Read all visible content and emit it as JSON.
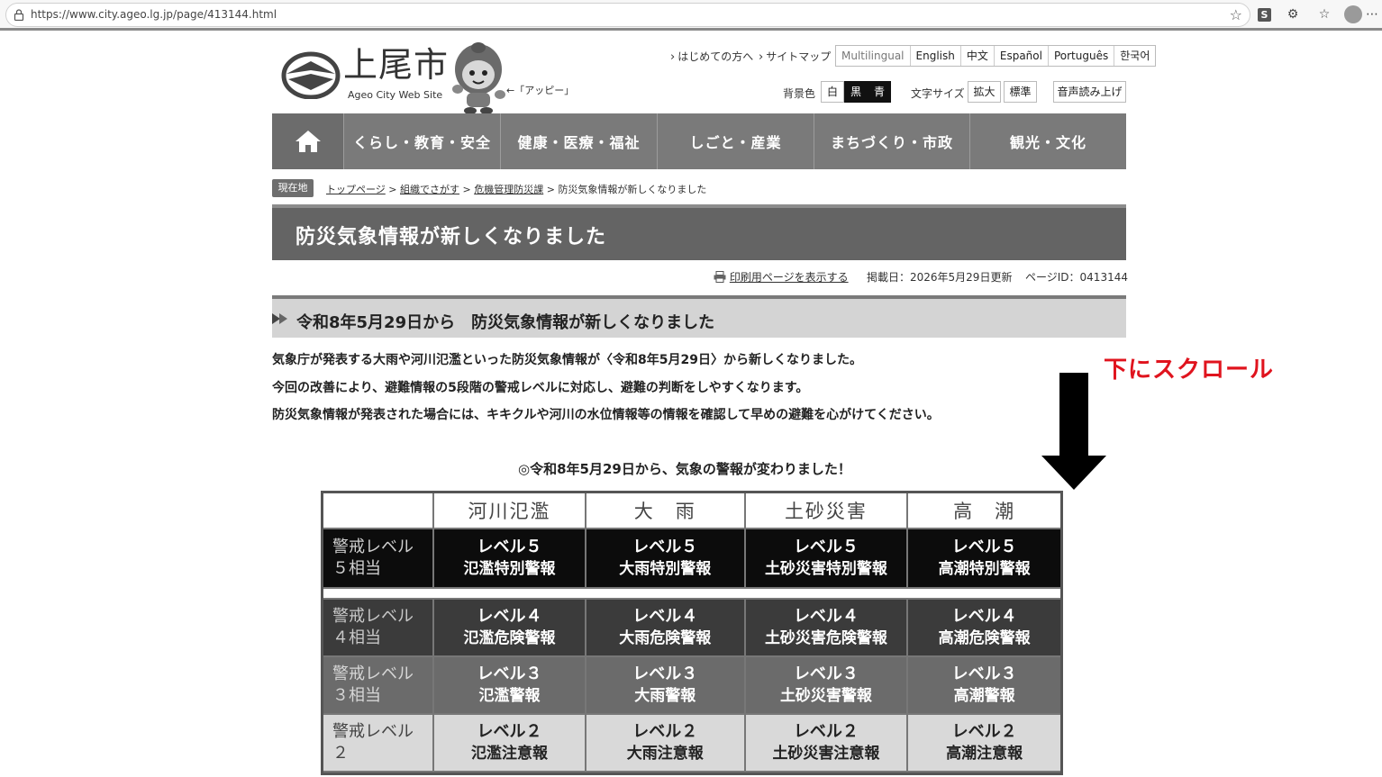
{
  "browser": {
    "url": "https://www.city.ageo.lg.jp/page/413144.html",
    "ext_label": "S"
  },
  "header": {
    "logo_title": "上尾市",
    "logo_sub": "Ageo City Web Site",
    "mascot_label": "←「アッピー」",
    "link_first": "はじめての方へ",
    "link_sitemap": "サイトマップ",
    "languages": [
      "Multilingual",
      "English",
      "中文",
      "Español",
      "Português",
      "한국어"
    ],
    "bg_label": "背景色",
    "bg_white": "白",
    "bg_black": "黒",
    "bg_blue": "青",
    "font_label": "文字サイズ",
    "font_large": "拡大",
    "font_normal": "標準",
    "speech": "音声読み上げ"
  },
  "nav": [
    "くらし・教育・安全",
    "健康・医療・福祉",
    "しごと・産業",
    "まちづくり・市政",
    "観光・文化"
  ],
  "breadcrumb": {
    "here": "現在地",
    "items": [
      "トップページ",
      "組織でさがす",
      "危機管理防災課"
    ],
    "current": "防災気象情報が新しくなりました",
    "sep": ">"
  },
  "page": {
    "title": "防災気象情報が新しくなりました",
    "print_link": "印刷用ページを表示する",
    "posted": "掲載日：2026年5月29日更新",
    "page_id": "ページID：0413144",
    "section_heading": "令和8年5月29日から　防災気象情報が新しくなりました",
    "para1": "気象庁が発表する大雨や河川氾濫といった防災気象情報が〈令和8年5月29日〉から新しくなりました。",
    "para2": "今回の改善により、避難情報の5段階の警戒レベルに対応し、避難の判断をしやすくなります。",
    "para3": "防災気象情報が発表された場合には、キキクルや河川の水位情報等の情報を確認して早めの避難を心がけてください。",
    "table_caption": "◎令和8年5月29日から、気象の警報が変わりました！",
    "scroll_note": "下にスクロール"
  },
  "table": {
    "headers": [
      "河川氾濫",
      "大　雨",
      "土砂災害",
      "高　潮"
    ],
    "rows": [
      {
        "label1": "警戒レベル",
        "label2": "５相当",
        "cells": [
          [
            "レベル５",
            "氾濫特別警報"
          ],
          [
            "レベル５",
            "大雨特別警報"
          ],
          [
            "レベル５",
            "土砂災害特別警報"
          ],
          [
            "レベル５",
            "高潮特別警報"
          ]
        ]
      },
      {
        "label1": "警戒レベル",
        "label2": "４相当",
        "cells": [
          [
            "レベル４",
            "氾濫危険警報"
          ],
          [
            "レベル４",
            "大雨危険警報"
          ],
          [
            "レベル４",
            "土砂災害危険警報"
          ],
          [
            "レベル４",
            "高潮危険警報"
          ]
        ]
      },
      {
        "label1": "警戒レベル",
        "label2": "３相当",
        "cells": [
          [
            "レベル３",
            "氾濫警報"
          ],
          [
            "レベル３",
            "大雨警報"
          ],
          [
            "レベル３",
            "土砂災害警報"
          ],
          [
            "レベル３",
            "高潮警報"
          ]
        ]
      },
      {
        "label1": "警戒レベル",
        "label2": "２",
        "cells": [
          [
            "レベル２",
            "氾濫注意報"
          ],
          [
            "レベル２",
            "大雨注意報"
          ],
          [
            "レベル２",
            "土砂災害注意報"
          ],
          [
            "レベル２",
            "高潮注意報"
          ]
        ]
      }
    ]
  },
  "colors": {
    "nav_bg": "#7a7a7a",
    "title_bg": "#646464",
    "scroll_note": "#e0141e",
    "level5": "#0c0c0c",
    "level4": "#3b3b3b",
    "level3": "#6b6b6b",
    "level2": "#d9d9d9"
  },
  "icons": [
    "lock-icon",
    "bookmark-star-icon",
    "extension-icon",
    "favorites-icon",
    "profile-icon",
    "more-icon",
    "home-icon",
    "printer-icon",
    "arrow-down-icon"
  ]
}
